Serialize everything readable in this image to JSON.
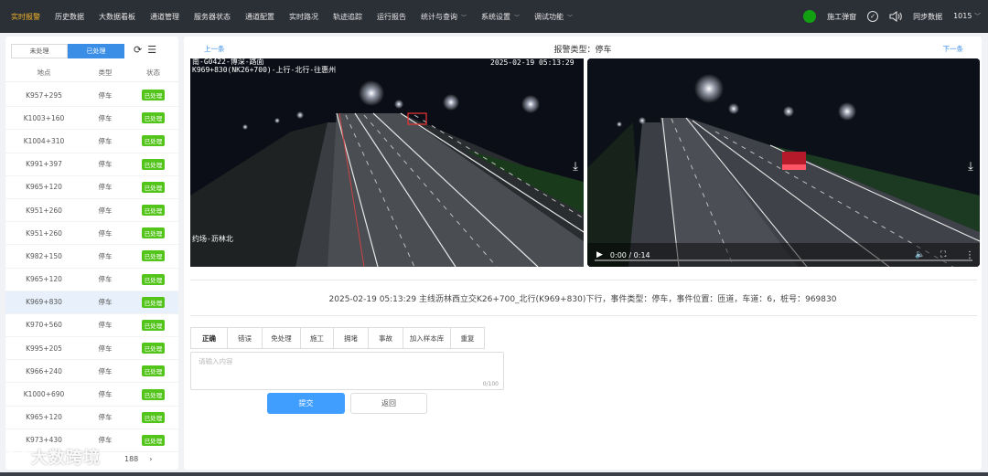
{
  "nav": {
    "items": [
      "实时报警",
      "历史数据",
      "大数据看板",
      "通道管理",
      "服务器状态",
      "通道配置",
      "实时路况",
      "轨迹追踪",
      "运行报告",
      "统计与查询",
      "系统设置",
      "调试功能"
    ],
    "active_index": 0,
    "dropdown_indices": [
      9,
      10,
      11
    ],
    "right": {
      "construction": "施工弹窗",
      "sync": "同步数据",
      "user": "1015"
    }
  },
  "left": {
    "seg_unprocessed": "未处理",
    "seg_processed": "已处理",
    "headers": {
      "location": "地点",
      "type": "类型",
      "status": "状态"
    },
    "rows": [
      {
        "loc": "K957+295",
        "type": "停车",
        "status": "已处理"
      },
      {
        "loc": "K1003+160",
        "type": "停车",
        "status": "已处理"
      },
      {
        "loc": "K1004+310",
        "type": "停车",
        "status": "已处理"
      },
      {
        "loc": "K991+397",
        "type": "停车",
        "status": "已处理"
      },
      {
        "loc": "K965+120",
        "type": "停车",
        "status": "已处理"
      },
      {
        "loc": "K951+260",
        "type": "停车",
        "status": "已处理"
      },
      {
        "loc": "K951+260",
        "type": "停车",
        "status": "已处理"
      },
      {
        "loc": "K982+150",
        "type": "停车",
        "status": "已处理"
      },
      {
        "loc": "K965+120",
        "type": "停车",
        "status": "已处理"
      },
      {
        "loc": "K969+830",
        "type": "停车",
        "status": "已处理"
      },
      {
        "loc": "K970+560",
        "type": "停车",
        "status": "已处理"
      },
      {
        "loc": "K995+205",
        "type": "停车",
        "status": "已处理"
      },
      {
        "loc": "K966+240",
        "type": "停车",
        "status": "已处理"
      },
      {
        "loc": "K1000+690",
        "type": "停车",
        "status": "已处理"
      },
      {
        "loc": "K965+120",
        "type": "停车",
        "status": "已处理"
      },
      {
        "loc": "K973+430",
        "type": "停车",
        "status": "已处理"
      }
    ],
    "selected_index": 9,
    "pager_text": "188",
    "pager_next": "›"
  },
  "main": {
    "prev": "上一条",
    "next": "下一条",
    "alarm_title": "报警类型：停车",
    "cam1": {
      "overlay_line1": "南-G0422-博深-路面",
      "overlay_line2": "K969+830(NK26+700)-上行-北行-往惠州",
      "timestamp": "2025-02-19 05:13:29",
      "bottom_label": "约场-沥林北"
    },
    "video": {
      "time": "0:00 / 0:14",
      "progress": 0
    },
    "event_text": "2025-02-19 05:13:29 主线沥林西立交K26+700_北行(K969+830)下行，事件类型：停车，事件位置：匝道，车道：6，桩号：969830",
    "tags": [
      "正确",
      "错误",
      "免处理",
      "施工",
      "拥堵",
      "事故",
      "加入样本库",
      "重复"
    ],
    "active_tag": 0,
    "textarea_placeholder": "请输入内容",
    "char_count": "0/100",
    "submit": "提交",
    "back": "返回"
  },
  "watermark": "大数跨境",
  "colors": {
    "nav_bg": "#2b2f36",
    "nav_active": "#f0b429",
    "primary": "#409eff",
    "badge": "#52c41a",
    "status_ok": "#12a012"
  }
}
